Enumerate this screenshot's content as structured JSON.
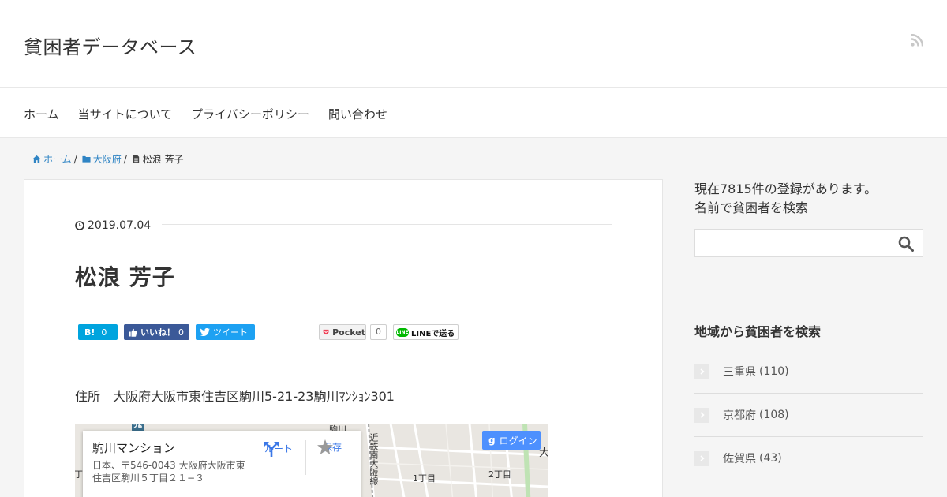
{
  "header": {
    "site_title": "貧困者データベース",
    "rss_icon": "rss-icon"
  },
  "nav": [
    {
      "label": "ホーム"
    },
    {
      "label": "当サイトについて"
    },
    {
      "label": "プライバシーポリシー"
    },
    {
      "label": "問い合わせ"
    }
  ],
  "breadcrumb": {
    "home": "ホーム",
    "category": "大阪府",
    "current": "松浪 芳子"
  },
  "post": {
    "date": "2019.07.04",
    "title": "松浪 芳子",
    "address": "住所　大阪府大阪市東住吉区駒川5-21-23駒川ﾏﾝｼｮﾝ301"
  },
  "share": {
    "hatena_label": "B!",
    "hatena_count": "0",
    "facebook_label": "いいね！",
    "facebook_count": "0",
    "twitter_label": "ツイート",
    "pocket_label": "Pocket",
    "pocket_count": "0",
    "line_label": "LINEで送る"
  },
  "map": {
    "place_name": "駒川マンション",
    "place_address": "日本、〒546-0043 大阪府大阪市東住吉区駒川５丁目２１−３",
    "route_label": "ルート",
    "save_label": "保存",
    "login_label": "ログイン",
    "labels": {
      "komagawa": "駒川",
      "route26": "26",
      "rail": "近鉄南大阪線",
      "chome1": "1丁目",
      "chome2": "2丁目",
      "dai": "大",
      "left_edge": "丁目"
    }
  },
  "sidebar": {
    "count_text": "現在7815件の登録があります。",
    "search_heading": "名前で貧困者を検索",
    "region_heading": "地域から貧困者を検索",
    "regions": [
      {
        "name": "三重県",
        "count": "(110)"
      },
      {
        "name": "京都府",
        "count": "(108)"
      },
      {
        "name": "佐賀県",
        "count": "(43)"
      }
    ]
  },
  "colors": {
    "link": "#2f84c4",
    "hatena": "#00a4de",
    "facebook": "#3b5998",
    "twitter": "#1da1f2",
    "line": "#00b900",
    "maps_blue": "#4d90fe"
  }
}
